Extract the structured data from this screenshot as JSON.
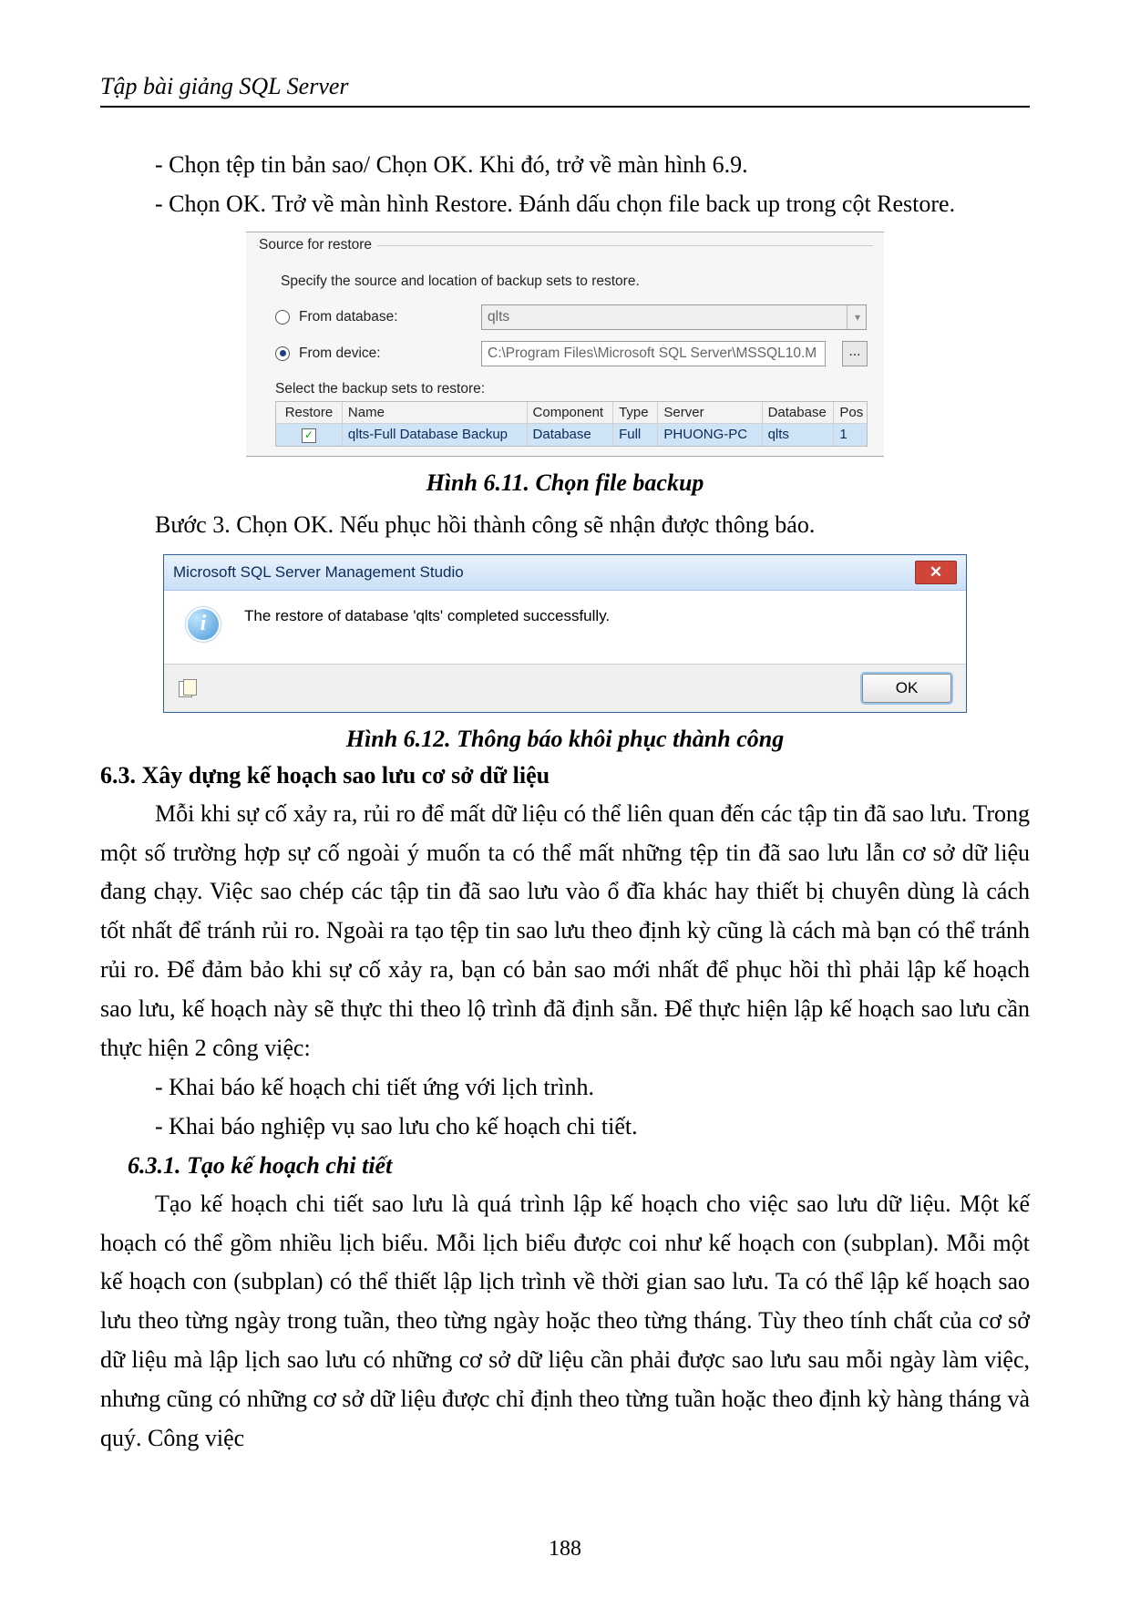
{
  "header": {
    "title": "Tập bài giảng SQL Server"
  },
  "body": {
    "line1": "- Chọn tệp tin bản sao/ Chọn OK. Khi đó, trở về màn hình 6.9.",
    "line2": "- Chọn OK. Trở về màn hình Restore. Đánh dấu chọn file back up trong cột Restore."
  },
  "fig611": {
    "group": "Source for restore",
    "desc": "Specify the source and location of backup sets to restore.",
    "radio1": "From database:",
    "radio1_val": "qlts",
    "radio2": "From device:",
    "radio2_val": "C:\\Program Files\\Microsoft SQL Server\\MSSQL10.M",
    "browse": "...",
    "select_label": "Select the backup sets to restore:",
    "columns": {
      "c0": "Restore",
      "c1": "Name",
      "c2": "Component",
      "c3": "Type",
      "c4": "Server",
      "c5": "Database",
      "c6": "Pos"
    },
    "row0": {
      "check": "✓",
      "name": "qlts-Full Database Backup",
      "component": "Database",
      "type": "Full",
      "server": "PHUONG-PC",
      "database": "qlts",
      "pos": "1"
    },
    "caption": "Hình 6.11. Chọn file backup"
  },
  "step3": "Bước 3. Chọn OK. Nếu phục hồi thành công sẽ nhận được thông báo.",
  "fig612": {
    "title": "Microsoft SQL Server Management Studio",
    "close": "✕",
    "info_glyph": "i",
    "message": "The restore of database 'qlts' completed successfully.",
    "ok": "OK",
    "caption": "Hình 6.12.  Thông báo khôi phục thành công"
  },
  "section63": {
    "title": "6.3. Xây dựng kế hoạch sao lưu cơ sở dữ liệu",
    "para1": "Mỗi khi sự cố xảy ra, rủi ro để mất dữ liệu có thể liên quan đến các tập tin đã sao lưu. Trong một số trường hợp sự cố ngoài ý muốn ta có thể mất những tệp tin đã sao lưu lẫn cơ sở dữ liệu đang chạy. Việc sao chép các tập tin đã sao lưu vào ổ đĩa khác hay thiết bị chuyên dùng là cách tốt nhất để tránh rủi ro. Ngoài ra tạo tệp tin sao lưu theo định kỳ cũng là cách mà bạn có thể tránh rủi ro. Để đảm bảo khi sự cố xảy ra, bạn có bản sao mới nhất để phục hồi thì phải lập kế hoạch sao lưu, kế hoạch này sẽ thực thi theo lộ trình đã định sẵn. Để thực hiện lập kế hoạch sao lưu cần thực hiện 2 công việc:",
    "bullet1": "- Khai báo kế hoạch chi tiết ứng với lịch trình.",
    "bullet2": "- Khai báo nghiệp vụ sao lưu cho kế hoạch chi tiết."
  },
  "section631": {
    "title": "6.3.1. Tạo kế hoạch chi tiết",
    "para": "Tạo kế hoạch chi tiết sao lưu là quá trình lập kế hoạch cho việc sao lưu dữ liệu. Một kế hoạch có thể gồm nhiều lịch biểu. Mỗi lịch biểu được coi như kế hoạch con (subplan). Mỗi một kế hoạch con (subplan) có thể thiết lập lịch trình về thời gian sao lưu. Ta có thể lập kế hoạch sao lưu theo từng ngày trong tuần, theo từng ngày hoặc theo từng tháng. Tùy theo tính chất của cơ sở dữ liệu mà lập lịch sao lưu có những cơ sở dữ liệu cần phải được sao lưu sau mỗi ngày làm việc, nhưng cũng có những cơ sở dữ liệu được chỉ định theo từng tuần hoặc theo định kỳ hàng tháng và quý. Công việc"
  },
  "page_number": "188"
}
